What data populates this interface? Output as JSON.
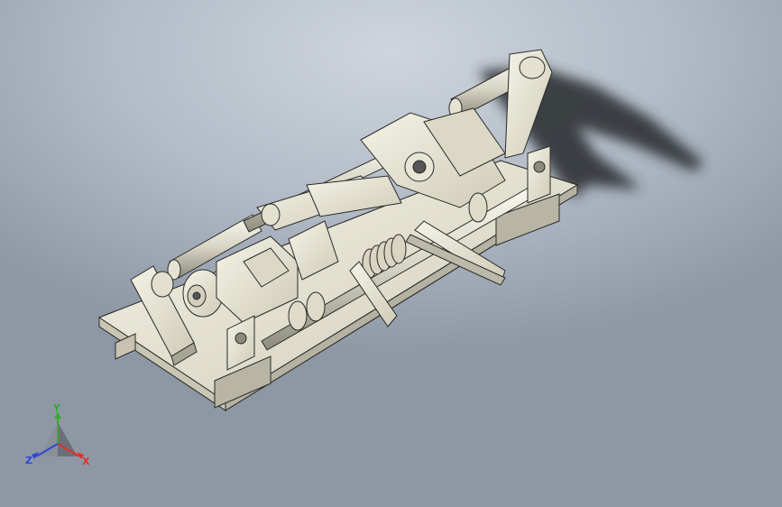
{
  "viewport": {
    "background_top": "#ced5dd",
    "background_bottom": "#8e98a5",
    "model_color": "#ece9d9",
    "edge_color": "#2a2a2a",
    "shadow_color": "#2e3136"
  },
  "triad": {
    "x_label": "X",
    "y_label": "Y",
    "z_label": "Z",
    "x_color": "#e0302a",
    "y_color": "#3aa832",
    "z_color": "#2f45d8"
  }
}
